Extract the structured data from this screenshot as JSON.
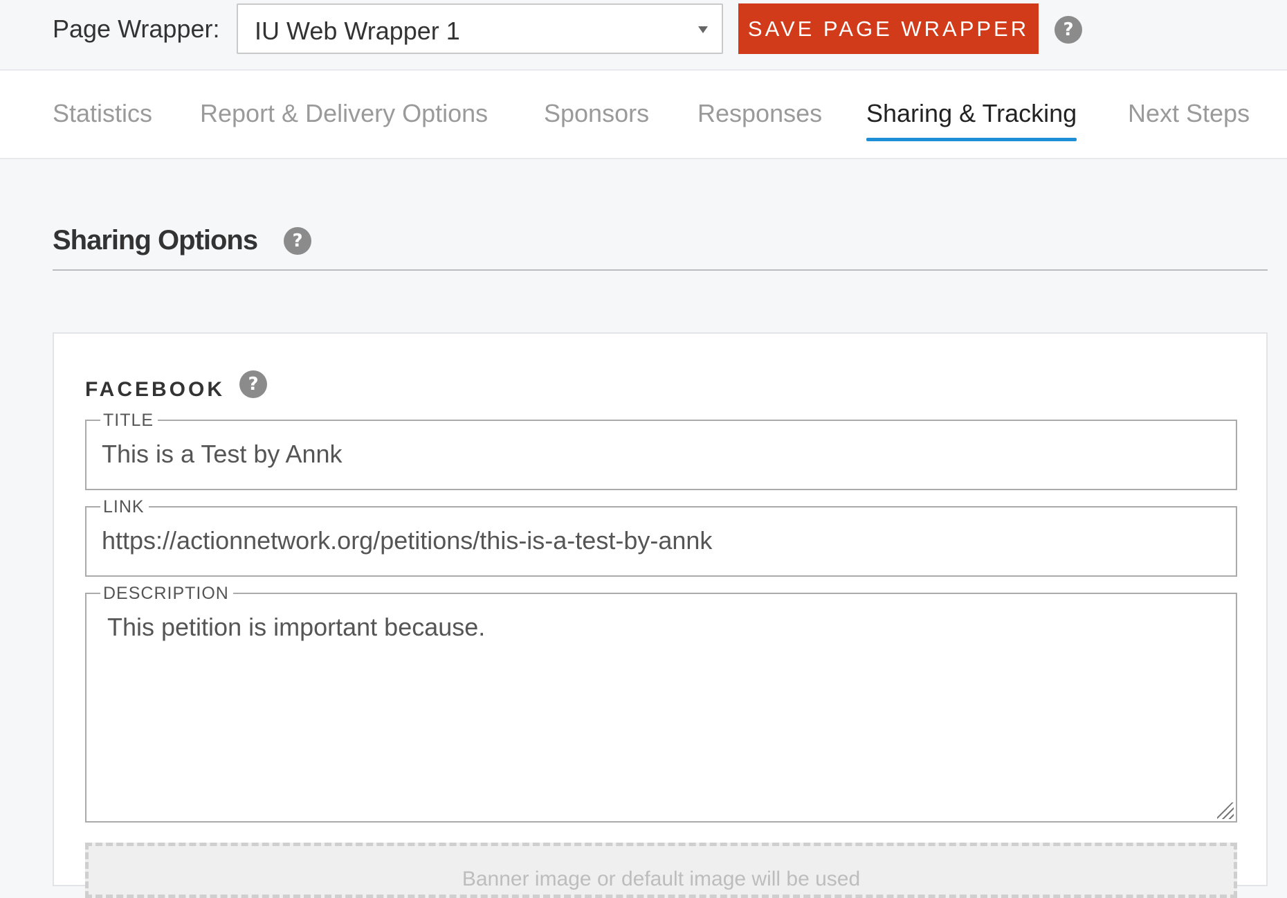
{
  "wrapper": {
    "label": "Page Wrapper:",
    "selected": "IU Web Wrapper 1",
    "save_label": "SAVE PAGE WRAPPER",
    "help": "?"
  },
  "tabs": [
    {
      "label": "Statistics",
      "active": false
    },
    {
      "label": "Report & Delivery Options",
      "active": false
    },
    {
      "label": "Sponsors",
      "active": false
    },
    {
      "label": "Responses",
      "active": false
    },
    {
      "label": "Sharing & Tracking",
      "active": true
    },
    {
      "label": "Next Steps",
      "active": false
    }
  ],
  "section": {
    "title": "Sharing Options",
    "help": "?"
  },
  "facebook": {
    "heading": "FACEBOOK",
    "help": "?",
    "title_legend": "TITLE",
    "title_value": "This is a Test by Annk",
    "link_legend": "LINK",
    "link_value": "https://actionnetwork.org/petitions/this-is-a-test-by-annk",
    "description_legend": "DESCRIPTION",
    "description_value": "This petition is important because.",
    "banner_note": "Banner image or default image will be used"
  },
  "colors": {
    "accent_button": "#d23b1a",
    "active_tab_underline": "#1e8fd6"
  },
  "icons": {
    "help": "question-circle-icon",
    "dropdown": "chevron-down-icon"
  }
}
